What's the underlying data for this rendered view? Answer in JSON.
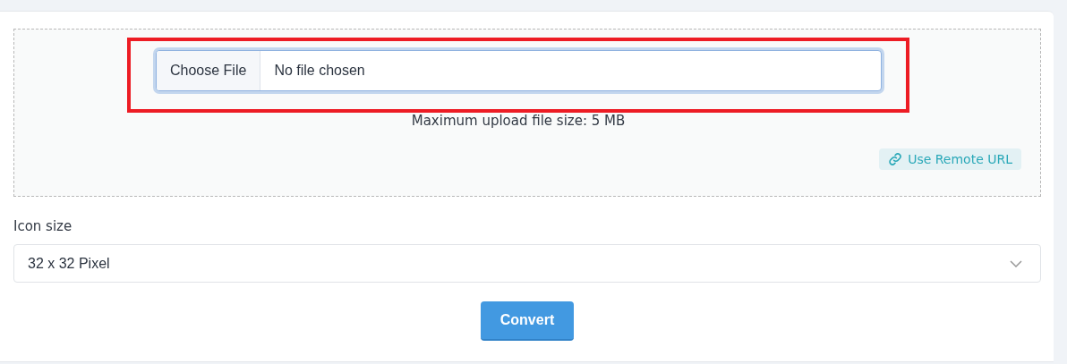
{
  "upload": {
    "file_input": {
      "button": "Choose File",
      "value": "No file chosen",
      "highlighted": true
    },
    "note": "Maximum upload file size: 5 MB",
    "remote_link": "Use Remote URL"
  },
  "icon_size": {
    "label": "Icon size",
    "value": "32 x 32 Pixel"
  },
  "buttons": [
    "Convert"
  ]
}
